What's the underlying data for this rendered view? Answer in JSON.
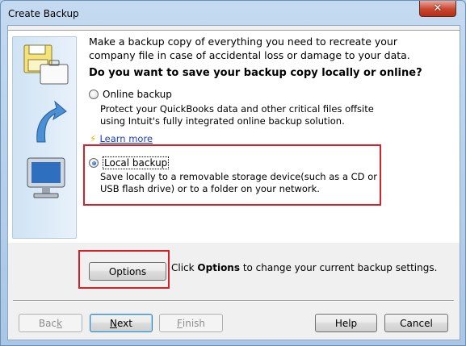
{
  "window": {
    "title": "Create Backup"
  },
  "intro": {
    "text": "Make a backup copy of everything you need to recreate your company file in case of accidental loss or damage to your data.",
    "question": "Do you want to save your backup copy locally or online?"
  },
  "online": {
    "label": "Online backup",
    "description": "Protect your QuickBooks data and other critical files offsite using Intuit's fully integrated online backup solution.",
    "selected": false,
    "learn_more": "Learn more"
  },
  "local": {
    "label": "Local backup",
    "description": "Save locally to a removable storage device(such as a CD or USB flash drive) or to a folder on your network.",
    "selected": true
  },
  "options": {
    "button_label": "Options",
    "hint_prefix": "Click ",
    "hint_bold": "Options",
    "hint_suffix": " to change your current backup settings."
  },
  "footer": {
    "back_pre": "Bac",
    "back_ul": "k",
    "back_post": "",
    "next_pre": "",
    "next_ul": "N",
    "next_post": "ext",
    "finish_pre": "",
    "finish_ul": "F",
    "finish_post": "inish",
    "help": "Help",
    "cancel": "Cancel"
  },
  "colors": {
    "highlight": "#d8202a",
    "link": "#1b3fb6",
    "close_button": "#c9452f"
  },
  "icons": [
    "close-icon",
    "floppy-briefcase-icon",
    "curved-arrow-icon",
    "monitor-icon",
    "bolt-icon"
  ]
}
